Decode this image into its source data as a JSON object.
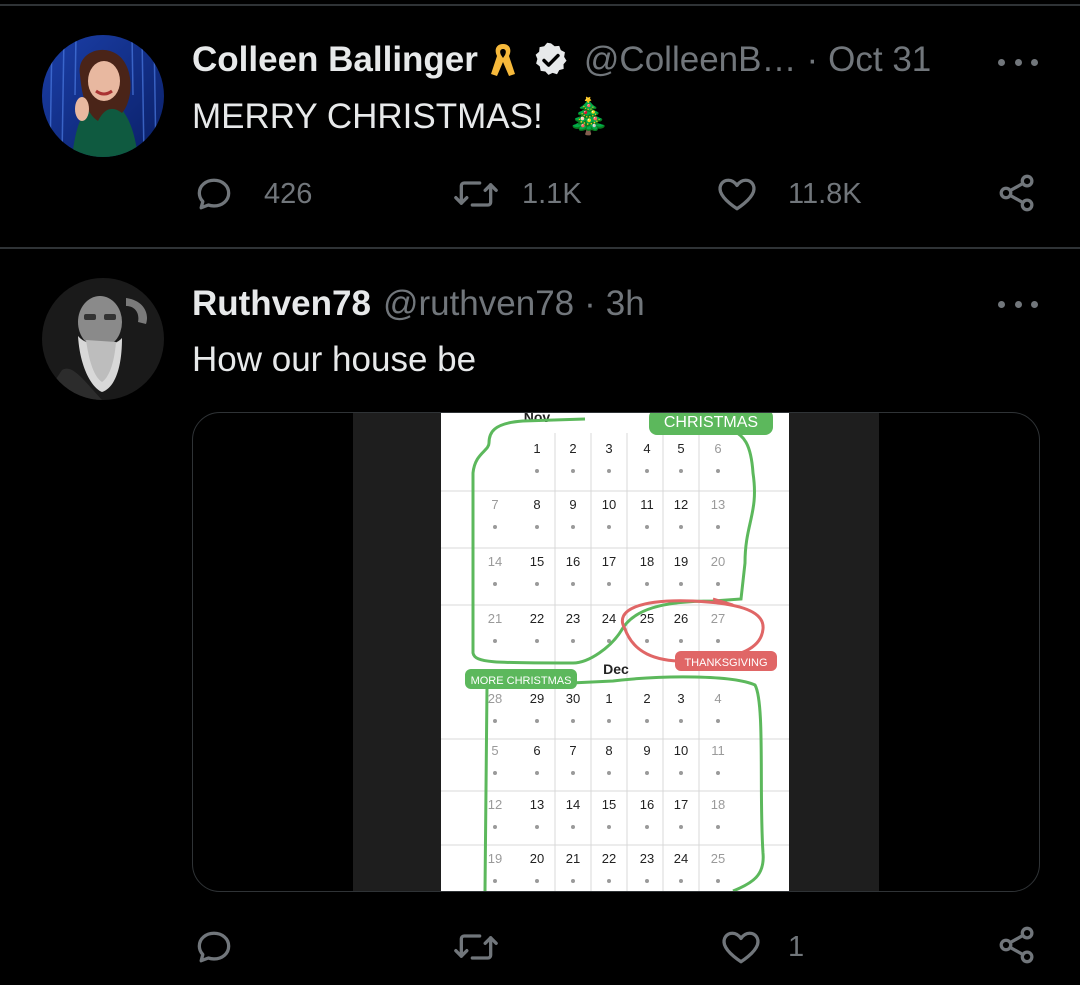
{
  "tweets": [
    {
      "name": "Colleen Ballinger",
      "handle": "@ColleenB…",
      "time": "Oct 31",
      "sep": "·",
      "text": "MERRY CHRISTMAS!",
      "emoji": "🎄",
      "replies": "426",
      "retweets": "1.1K",
      "likes": "11.8K"
    },
    {
      "name": "Ruthven78",
      "handle": "@ruthven78",
      "time": "3h",
      "sep": "·",
      "text": "How our house be",
      "replies": "",
      "retweets": "",
      "likes": "1"
    }
  ],
  "icons": {
    "ribbon": "ribbon-icon",
    "verified": "verified-badge-icon",
    "more": "more-options-icon",
    "reply": "reply-icon",
    "retweet": "retweet-icon",
    "like": "heart-icon",
    "share": "share-icon"
  },
  "calendar": {
    "nov_label": "Nov",
    "dec_label": "Dec",
    "christmas_label": "CHRISTMAS",
    "thanksgiving_label": "THANKSGIVING",
    "more_christmas_label": "MORE CHRISTMAS",
    "rows": [
      [
        "",
        "1",
        "2",
        "3",
        "4",
        "5",
        "6"
      ],
      [
        "7",
        "8",
        "9",
        "10",
        "11",
        "12",
        "13"
      ],
      [
        "14",
        "15",
        "16",
        "17",
        "18",
        "19",
        "20"
      ],
      [
        "21",
        "22",
        "23",
        "24",
        "25",
        "26",
        "27"
      ],
      [
        "28",
        "29",
        "30",
        "1",
        "2",
        "3",
        "4"
      ],
      [
        "5",
        "6",
        "7",
        "8",
        "9",
        "10",
        "11"
      ],
      [
        "12",
        "13",
        "14",
        "15",
        "16",
        "17",
        "18"
      ],
      [
        "19",
        "20",
        "21",
        "22",
        "23",
        "24",
        "25"
      ]
    ],
    "colors": {
      "green": "#5cb85c",
      "red": "#e06666"
    }
  }
}
